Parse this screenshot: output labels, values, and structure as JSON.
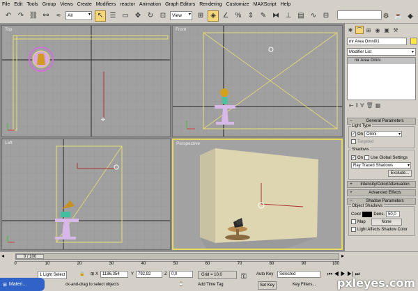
{
  "menu": [
    "File",
    "Edit",
    "Tools",
    "Group",
    "Views",
    "Create",
    "Modifiers",
    "reactor",
    "Animation",
    "Graph Editors",
    "Rendering",
    "Customize",
    "MAXScript",
    "Help"
  ],
  "toolbar": {
    "selection_filter": "All",
    "ref_coord": "View",
    "named_sel_placeholder": "",
    "icons": [
      "undo-icon",
      "redo-icon",
      "link-icon",
      "unlink-icon",
      "bind-icon",
      "select-icon",
      "select-by-name-icon",
      "region-select-icon",
      "move-icon",
      "rotate-icon",
      "scale-icon",
      "pivot-icon",
      "snap-icon",
      "angle-snap-icon",
      "percent-snap-icon",
      "spinner-snap-icon",
      "named-sets-icon",
      "mirror-icon",
      "align-icon",
      "layer-icon",
      "curve-editor-icon",
      "schematic-icon",
      "material-editor-icon",
      "render-setup-icon",
      "render-icon"
    ]
  },
  "viewports": [
    {
      "label": "Top",
      "active": false
    },
    {
      "label": "Front",
      "active": false
    },
    {
      "label": "Left",
      "active": false
    },
    {
      "label": "Perspective",
      "active": true
    }
  ],
  "command_panel": {
    "tabs": [
      "create-icon",
      "modify-icon",
      "hierarchy-icon",
      "motion-icon",
      "display-icon",
      "utilities-icon"
    ],
    "object_name": "mr Area Omni01",
    "object_color": "#ffe640",
    "modifier_list": "Modifier List",
    "stack_item": "mr Area Omni",
    "general_params": {
      "title": "General Parameters",
      "light_type_label": "Light Type",
      "on_label": "On",
      "on_checked": true,
      "light_type": "Omni",
      "targeted_label": "Targeted",
      "shadows_label": "Shadows",
      "shadows_on_label": "On",
      "shadows_on_checked": true,
      "use_global_label": "Use Global Settings",
      "shadow_type": "Ray Traced Shadows",
      "exclude_label": "Exclude..."
    },
    "rollouts": [
      "Intensity/Color/Attenuation",
      "Advanced Effects"
    ],
    "shadow_params": {
      "title": "Shadow Parameters",
      "object_shadows_label": "Object Shadows:",
      "color_label": "Color",
      "shadow_color": "#000000",
      "dens_label": "Dens.",
      "dens_value": "50,0",
      "map_label": "Map",
      "map_value": "None",
      "light_affects_label": "Light Affects Shadow Color"
    }
  },
  "timeline": {
    "frame_display": "0 / 100",
    "ticks": [
      "0",
      "10",
      "20",
      "30",
      "40",
      "50",
      "60",
      "70",
      "80",
      "90",
      "100"
    ]
  },
  "status": {
    "selection": "1 Light Select",
    "prompt": "ck-and-drag to select objects",
    "x_label": "X",
    "x_value": "1186,354",
    "y_label": "Y",
    "y_value": "792,92",
    "z_label": "Z",
    "z_value": "0,0",
    "grid": "Grid = 10,0",
    "auto_key": "Auto Key",
    "set_key": "Set Key",
    "key_filter": "Selected",
    "key_filters": "Key Filters...",
    "time_tag": "Add Time Tag"
  },
  "taskbar": {
    "label": "Materi..."
  },
  "watermark": "pxleyes.com"
}
